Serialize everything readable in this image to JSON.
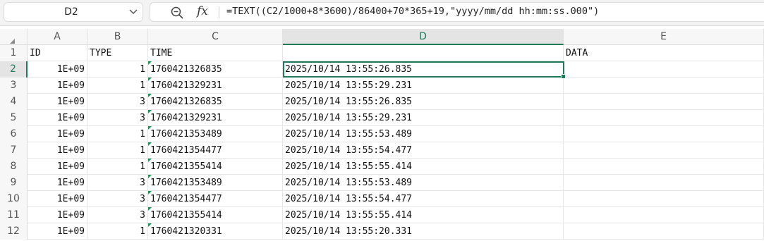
{
  "name_box": {
    "value": "D2"
  },
  "formula_bar": {
    "fx_label": "fx",
    "formula": "=TEXT((C2/1000+8*3600)/86400+70*365+19,\"yyyy/mm/dd hh:mm:ss.000\")"
  },
  "columns": [
    "A",
    "B",
    "C",
    "D",
    "E"
  ],
  "selected": {
    "column": "D",
    "row": "2"
  },
  "header_row": {
    "number": "1",
    "a": "ID",
    "b": "TYPE",
    "c": "TIME",
    "d": "",
    "e": "DATA"
  },
  "rows": [
    {
      "number": "2",
      "a": "1E+09",
      "b": "1",
      "c": "1760421326835",
      "d": "2025/10/14 13:55:26.835",
      "e": ""
    },
    {
      "number": "3",
      "a": "1E+09",
      "b": "1",
      "c": "1760421329231",
      "d": "2025/10/14 13:55:29.231",
      "e": ""
    },
    {
      "number": "4",
      "a": "1E+09",
      "b": "3",
      "c": "1760421326835",
      "d": "2025/10/14 13:55:26.835",
      "e": ""
    },
    {
      "number": "5",
      "a": "1E+09",
      "b": "3",
      "c": "1760421329231",
      "d": "2025/10/14 13:55:29.231",
      "e": ""
    },
    {
      "number": "6",
      "a": "1E+09",
      "b": "1",
      "c": "1760421353489",
      "d": "2025/10/14 13:55:53.489",
      "e": ""
    },
    {
      "number": "7",
      "a": "1E+09",
      "b": "1",
      "c": "1760421354477",
      "d": "2025/10/14 13:55:54.477",
      "e": ""
    },
    {
      "number": "8",
      "a": "1E+09",
      "b": "1",
      "c": "1760421355414",
      "d": "2025/10/14 13:55:55.414",
      "e": ""
    },
    {
      "number": "9",
      "a": "1E+09",
      "b": "3",
      "c": "1760421353489",
      "d": "2025/10/14 13:55:53.489",
      "e": ""
    },
    {
      "number": "10",
      "a": "1E+09",
      "b": "3",
      "c": "1760421354477",
      "d": "2025/10/14 13:55:54.477",
      "e": ""
    },
    {
      "number": "11",
      "a": "1E+09",
      "b": "3",
      "c": "1760421355414",
      "d": "2025/10/14 13:55:55.414",
      "e": ""
    },
    {
      "number": "12",
      "a": "1E+09",
      "b": "1",
      "c": "1760421320331",
      "d": "2025/10/14 13:55:20.331",
      "e": ""
    }
  ],
  "icons": {
    "name_box_dropdown": "chevron-down-icon",
    "zoom": "zoom-icon",
    "function": "fx-icon",
    "sheet_corner": "select-all-icon",
    "text_number_flag": "green-triangle-icon"
  },
  "colors": {
    "accent": "#1f7a57",
    "flag": "#1e8f4e",
    "header_bg": "#f7f7f7"
  }
}
